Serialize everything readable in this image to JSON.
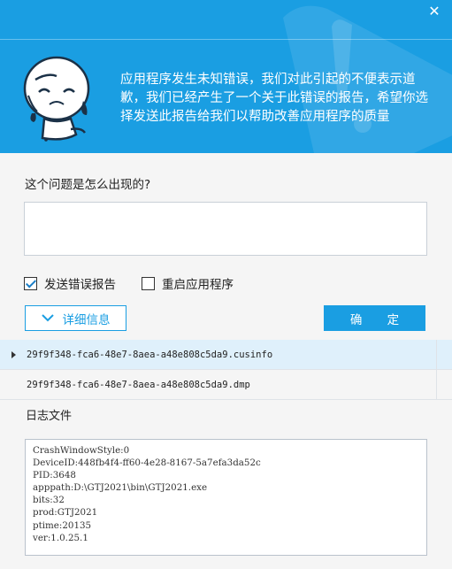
{
  "window": {
    "close_symbol": "✕"
  },
  "header": {
    "message": "应用程序发生未知错误，我们对此引起的不便表示道歉，我们已经产生了一个关于此错误的报告，希望你选择发送此报告给我们以帮助改善应用程序的质量",
    "accent_color": "#1a9ee2"
  },
  "form": {
    "question_label": "这个问题是怎么出现的?",
    "description_value": "",
    "description_placeholder": ""
  },
  "options": {
    "send_report": {
      "label": "发送错误报告",
      "checked": true
    },
    "restart_app": {
      "label": "重启应用程序",
      "checked": false
    }
  },
  "buttons": {
    "details_label": "详细信息",
    "ok_label": "确 定"
  },
  "files": [
    {
      "name": "29f9f348-fca6-48e7-8aea-a48e808c5da9.cusinfo",
      "selected": true
    },
    {
      "name": "29f9f348-fca6-48e7-8aea-a48e808c5da9.dmp",
      "selected": false
    }
  ],
  "log": {
    "label": "日志文件",
    "lines": [
      "CrashWindowStyle:0",
      "DeviceID:448fb4f4-ff60-4e28-8167-5a7efa3da52c",
      "PID:3648",
      "apppath:D:\\GTJ2021\\bin\\GTJ2021.exe",
      "bits:32",
      "prod:GTJ2021",
      "ptime:20135",
      "ver:1.0.25.1"
    ]
  }
}
